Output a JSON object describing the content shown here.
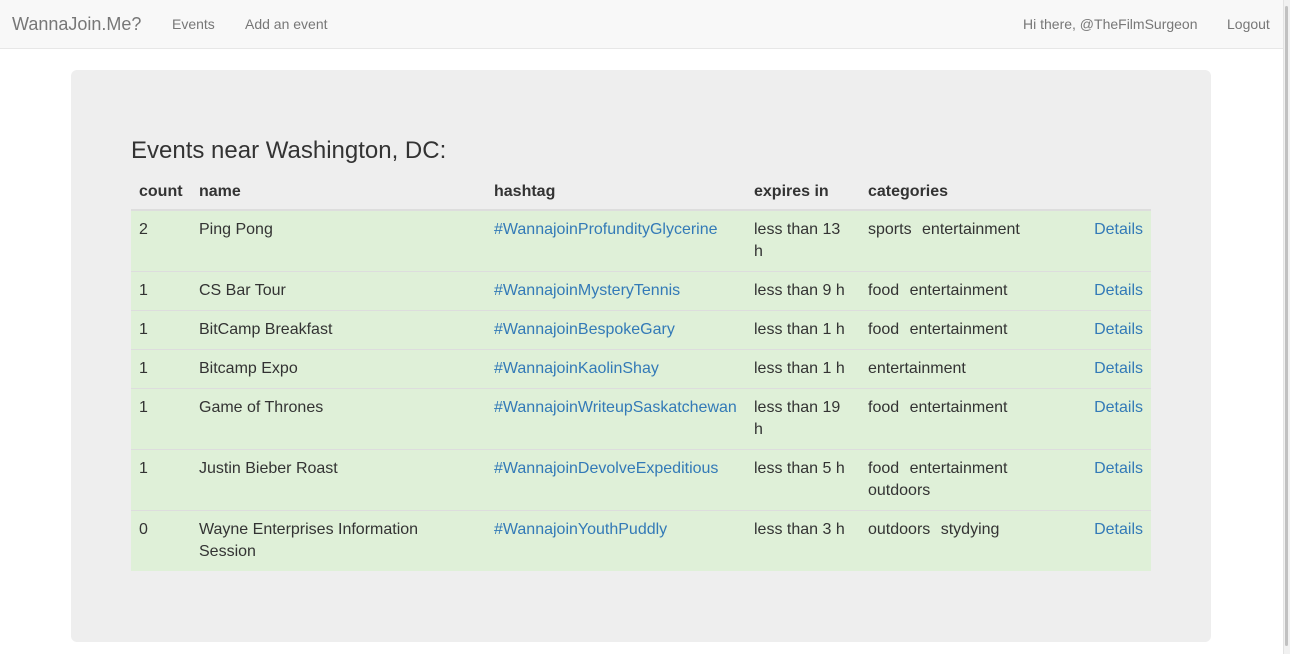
{
  "nav": {
    "brand": "WannaJoin.Me?",
    "events_label": "Events",
    "add_event_label": "Add an event",
    "greeting": "Hi there, @TheFilmSurgeon",
    "logout_label": "Logout"
  },
  "page": {
    "title": "Events near Washington, DC:"
  },
  "table": {
    "headers": {
      "count": "count",
      "name": "name",
      "hashtag": "hashtag",
      "expires": "expires in",
      "categories": "categories"
    },
    "details_label": "Details",
    "rows": [
      {
        "count": "2",
        "name": "Ping Pong",
        "hashtag": "#WannajoinProfundityGlycerine",
        "expires": "less than 13 h",
        "categories": [
          "sports",
          "entertainment"
        ]
      },
      {
        "count": "1",
        "name": "CS Bar Tour",
        "hashtag": "#WannajoinMysteryTennis",
        "expires": "less than 9 h",
        "categories": [
          "food",
          "entertainment"
        ]
      },
      {
        "count": "1",
        "name": "BitCamp Breakfast",
        "hashtag": "#WannajoinBespokeGary",
        "expires": "less than 1 h",
        "categories": [
          "food",
          "entertainment"
        ]
      },
      {
        "count": "1",
        "name": "Bitcamp Expo",
        "hashtag": "#WannajoinKaolinShay",
        "expires": "less than 1 h",
        "categories": [
          "entertainment"
        ]
      },
      {
        "count": "1",
        "name": "Game of Thrones",
        "hashtag": "#WannajoinWriteupSaskatchewan",
        "expires": "less than 19 h",
        "categories": [
          "food",
          "entertainment"
        ]
      },
      {
        "count": "1",
        "name": "Justin Bieber Roast",
        "hashtag": "#WannajoinDevolveExpeditious",
        "expires": "less than 5 h",
        "categories": [
          "food",
          "entertainment",
          "outdoors"
        ]
      },
      {
        "count": "0",
        "name": "Wayne Enterprises Information Session",
        "hashtag": "#WannajoinYouthPuddly",
        "expires": "less than 3 h",
        "categories": [
          "outdoors",
          "stydying"
        ]
      }
    ]
  }
}
